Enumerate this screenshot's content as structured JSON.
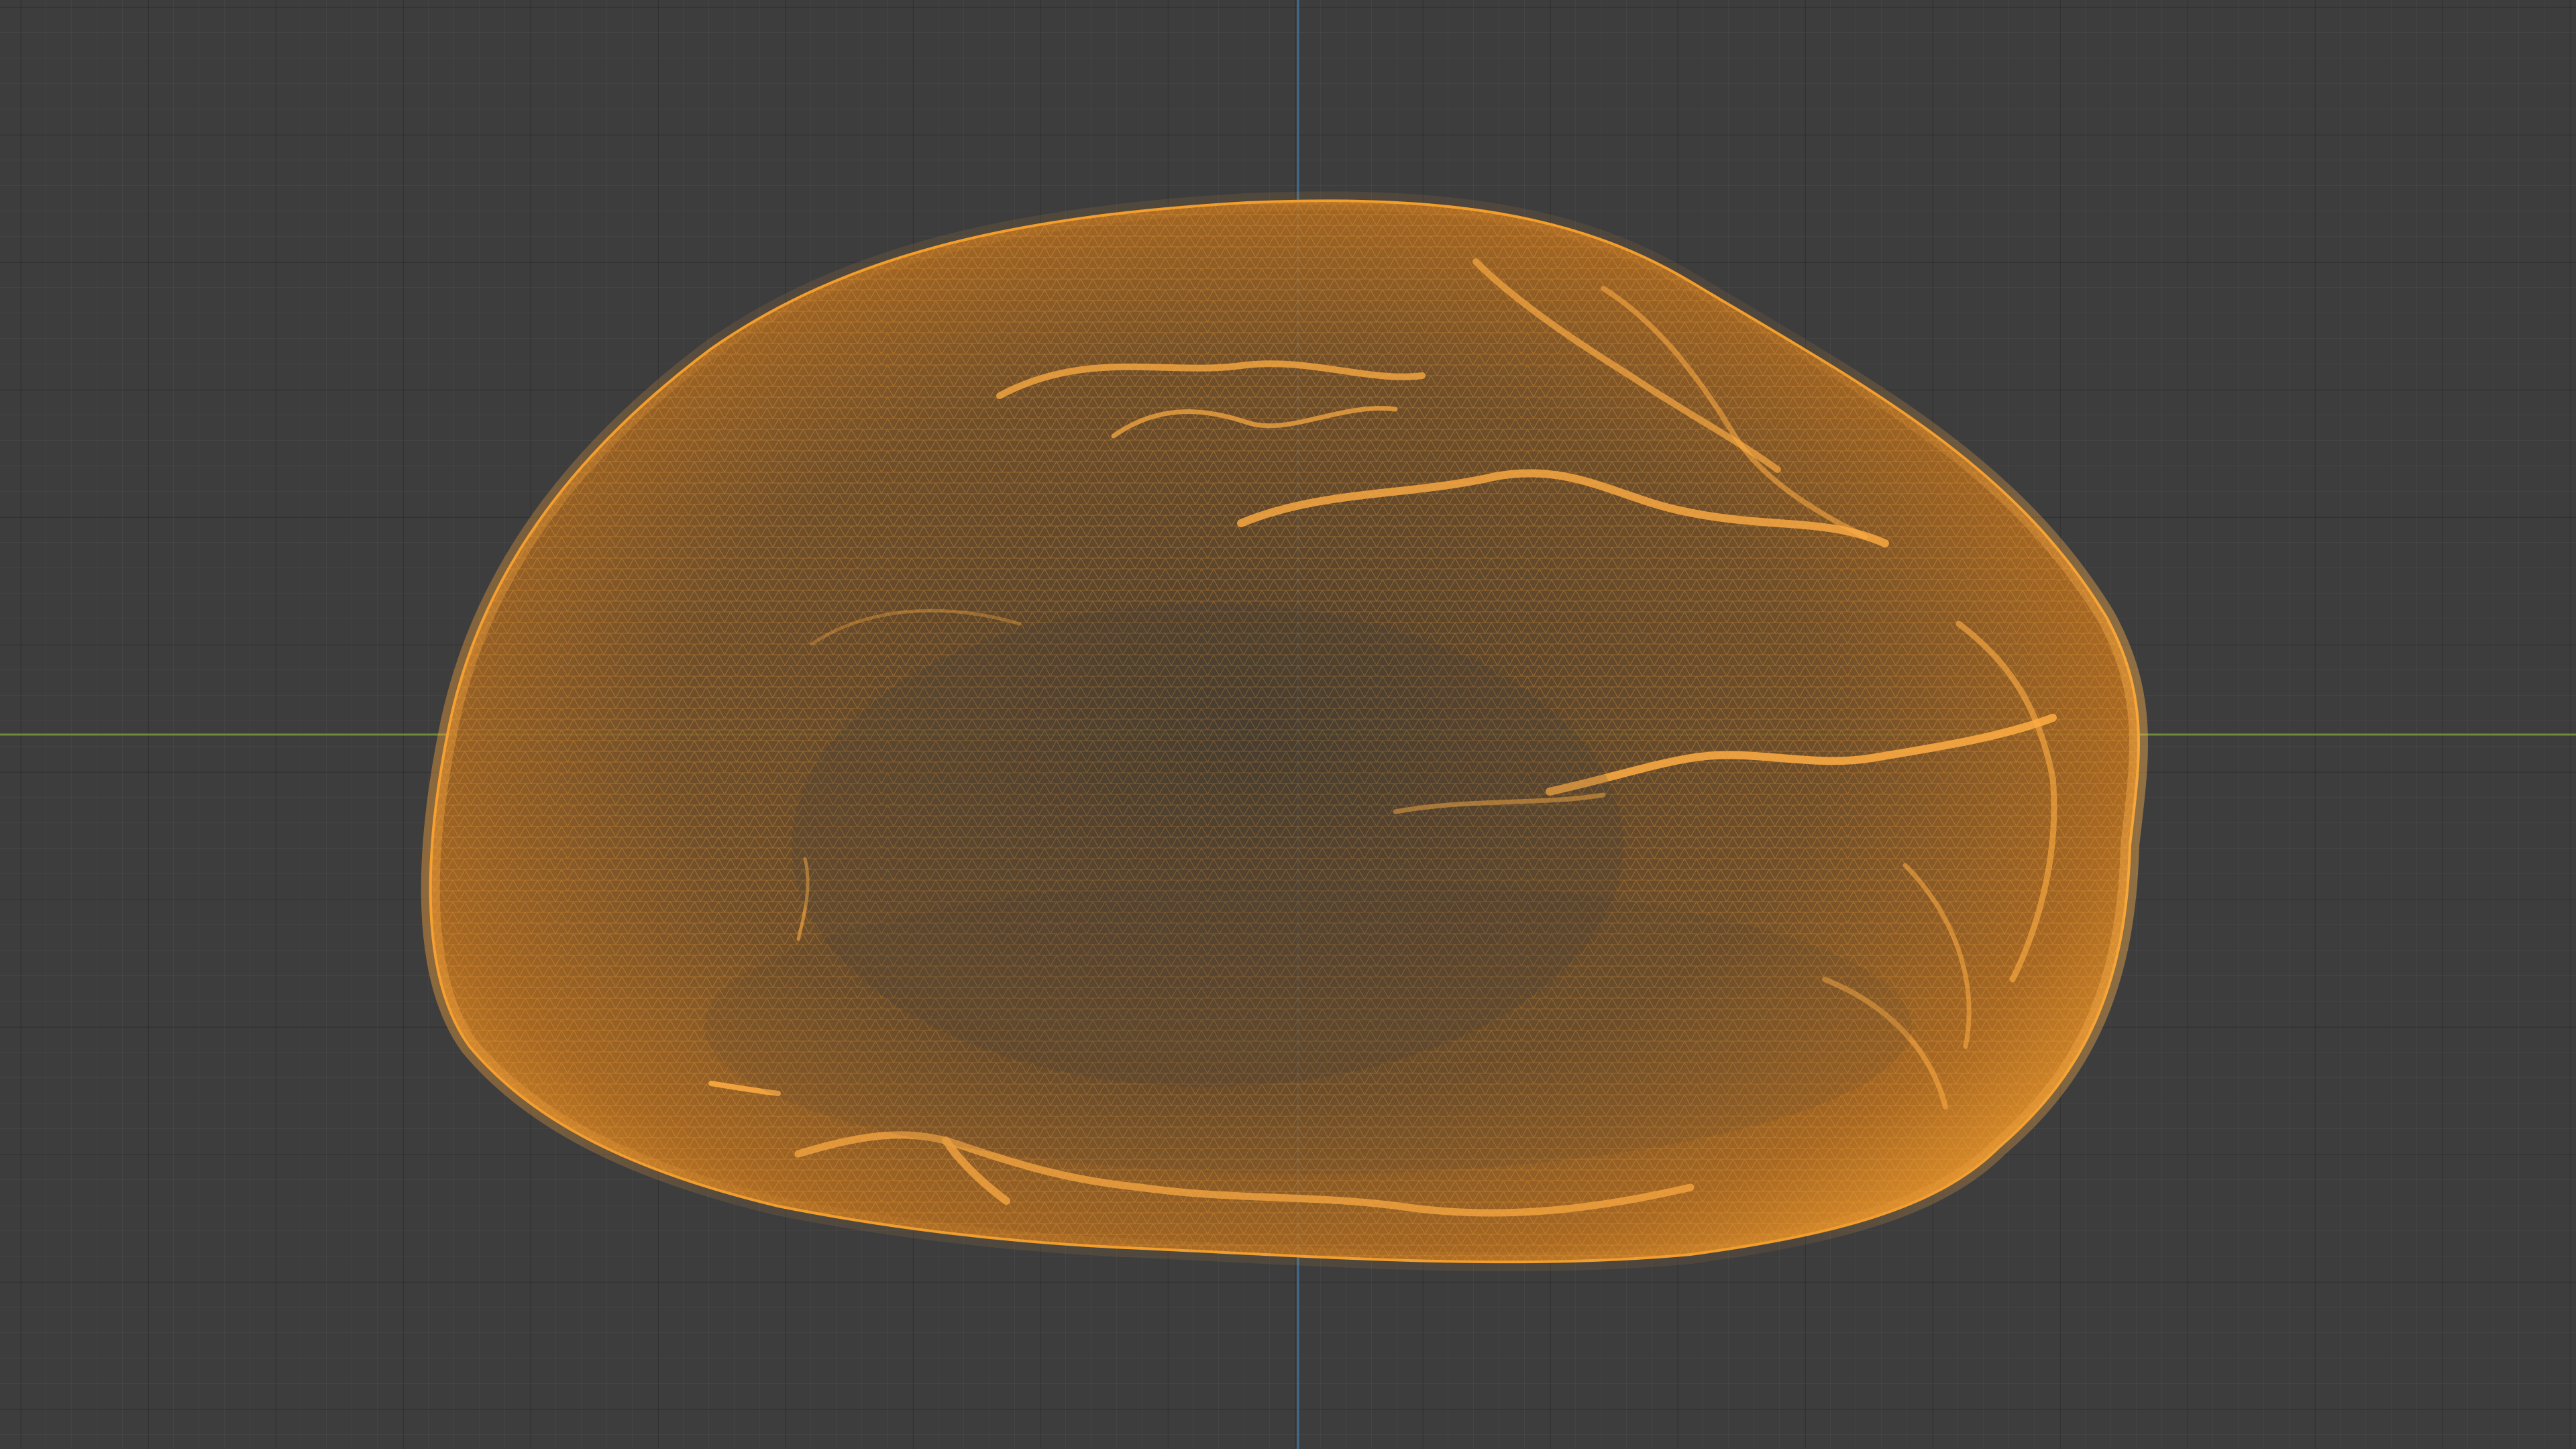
{
  "viewport": {
    "background_color": "#3d3d3d",
    "grid_color": "#353535",
    "x_axis_color": "#6f8a3b",
    "y_axis_color": "#3f6c93"
  },
  "mesh": {
    "display_mode": "wireframe",
    "wire_color": "#f29d2a",
    "icon": "mesh-object-icon"
  }
}
